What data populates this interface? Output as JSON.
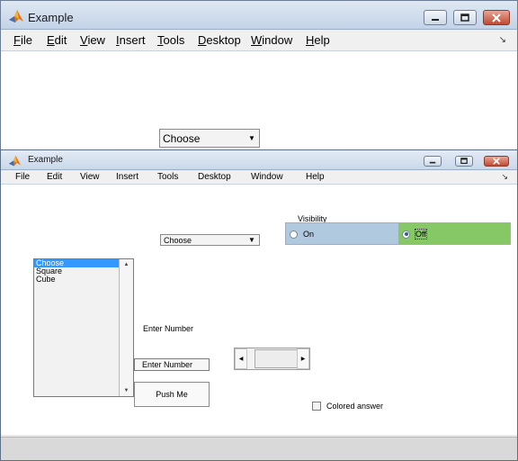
{
  "window_top": {
    "title": "Example",
    "menu": [
      {
        "mnemonic": "F",
        "rest": "ile"
      },
      {
        "mnemonic": "E",
        "rest": "dit"
      },
      {
        "mnemonic": "V",
        "rest": "iew"
      },
      {
        "mnemonic": "I",
        "rest": "nsert"
      },
      {
        "mnemonic": "T",
        "rest": "ools"
      },
      {
        "mnemonic": "D",
        "rest": "esktop"
      },
      {
        "mnemonic": "W",
        "rest": "indow"
      },
      {
        "mnemonic": "H",
        "rest": "elp"
      }
    ],
    "popup_value": "Choose"
  },
  "window_bottom": {
    "title": "Example",
    "menu": [
      "File",
      "Edit",
      "View",
      "Insert",
      "Tools",
      "Desktop",
      "Window",
      "Help"
    ],
    "popup_value": "Choose",
    "listbox": {
      "items": [
        "Choose",
        "Square",
        "Cube"
      ],
      "selected_index": 0
    },
    "enter_number_label": "Enter Number",
    "enter_number_field": "Enter Number",
    "push_button": "Push Me",
    "visibility": {
      "title": "Visibility",
      "options": [
        {
          "label": "On",
          "selected": false,
          "color": "#b0c9de"
        },
        {
          "label": "Off",
          "selected": true,
          "color": "#86c865"
        }
      ]
    },
    "checkbox": {
      "label": "Colored answer",
      "checked": false
    }
  },
  "icons": {
    "app": "matlab-logo-icon",
    "minimize": "minimize-icon",
    "maximize": "maximize-icon",
    "close": "close-icon",
    "dock": "dock-arrow-icon"
  }
}
